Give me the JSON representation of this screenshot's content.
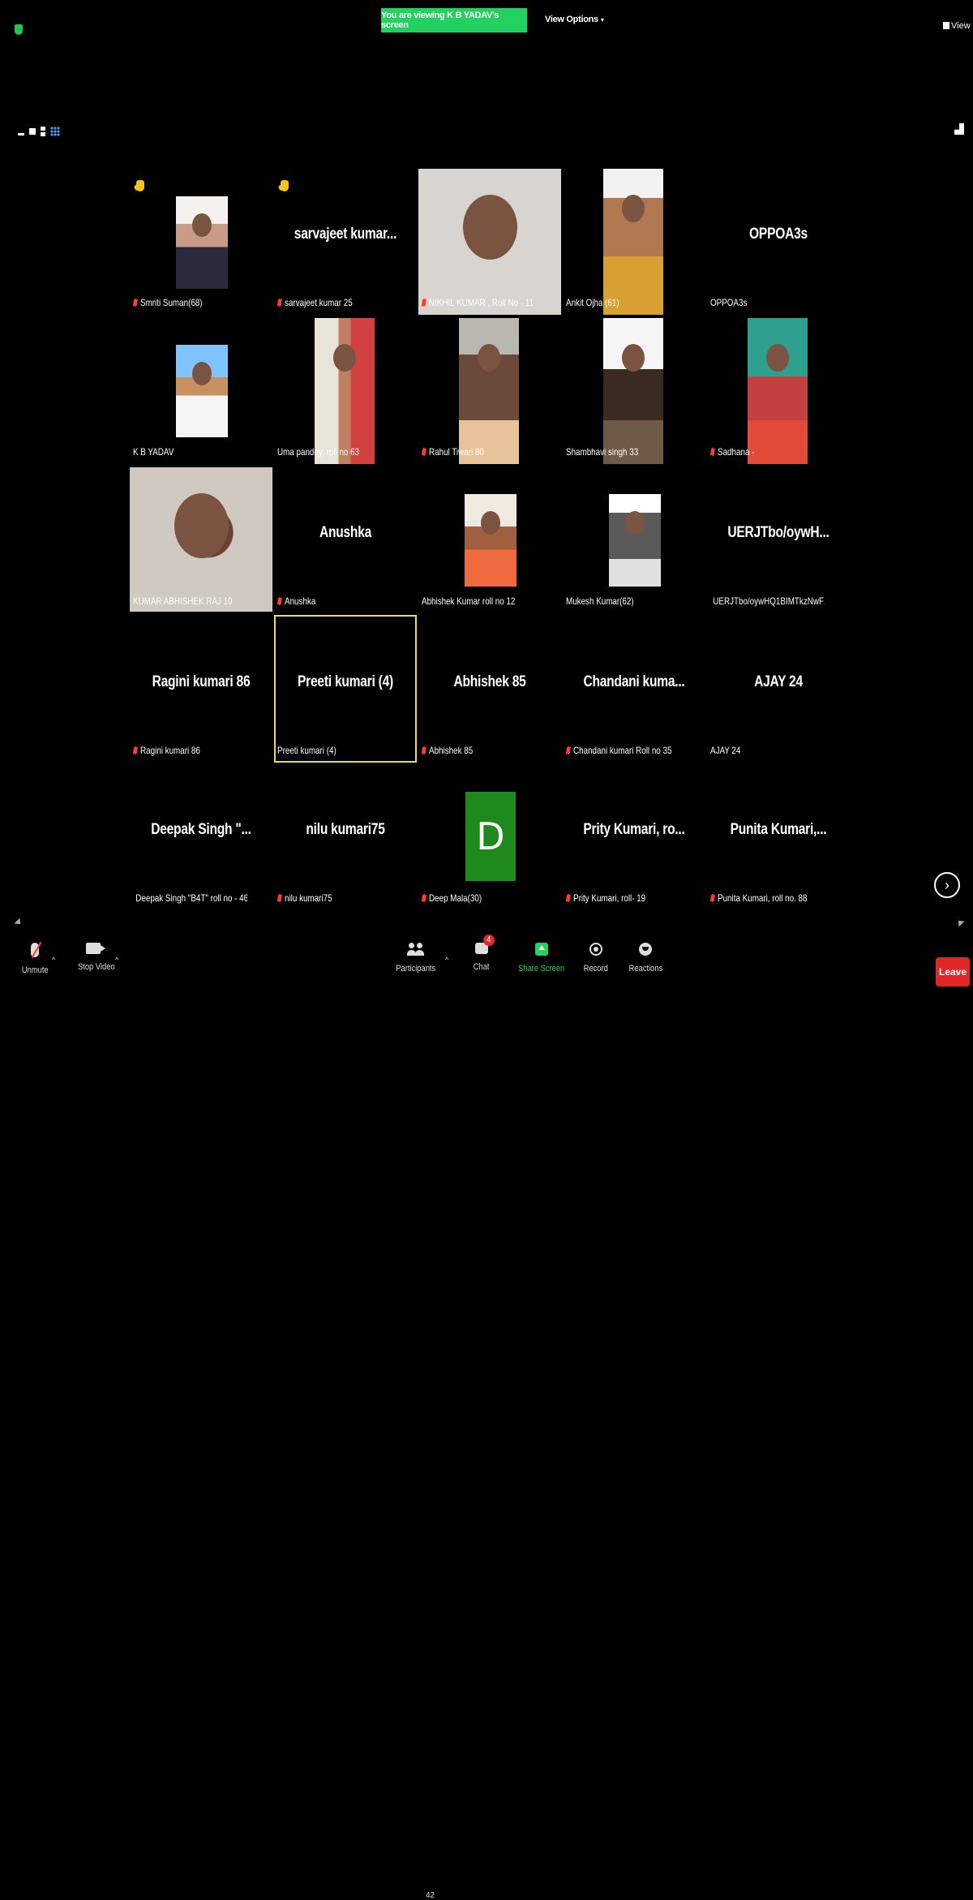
{
  "header": {
    "banner": "You are viewing K B YADAV's screen",
    "view_options": "View Options",
    "view_right": "View"
  },
  "tiles": [
    {
      "name": "Smriti Suman(68)",
      "big": "",
      "muted": true,
      "hand": true,
      "photo": "smriti"
    },
    {
      "name": "sarvajeet kumar 25",
      "big": "sarvajeet kumar...",
      "muted": true,
      "hand": true
    },
    {
      "name": "NIKHIL KUMAR , Roll No - 11",
      "big": "",
      "muted": true,
      "photo": "nikhil"
    },
    {
      "name": "Ankit Ojha (61)",
      "big": "",
      "muted": false,
      "photo": "ankit"
    },
    {
      "name": "OPPOA3s",
      "big": "OPPOA3s",
      "muted": false
    },
    {
      "name": "K B YADAV",
      "big": "",
      "muted": false,
      "photo": "kb"
    },
    {
      "name": "Uma pandey, roll no 63",
      "big": "",
      "muted": false,
      "photo": "uma"
    },
    {
      "name": "Rahul Tiwari 80",
      "big": "",
      "muted": true,
      "photo": "rahul"
    },
    {
      "name": "Shambhavi singh 33",
      "big": "",
      "muted": false,
      "photo": "sham"
    },
    {
      "name": "Sadhana -",
      "big": "",
      "muted": true,
      "photo": "sadhana"
    },
    {
      "name": "KUMAR ABHISHEK RAJ 10",
      "big": "",
      "muted": false,
      "photo": "abhiraj"
    },
    {
      "name": "Anushka",
      "big": "Anushka",
      "muted": true
    },
    {
      "name": "Abhishek Kumar roll no 12",
      "big": "",
      "muted": false,
      "photo": "abhishek12"
    },
    {
      "name": "Mukesh Kumar(62)",
      "big": "",
      "muted": false,
      "photo": "mukesh"
    },
    {
      "name": "UERJTbo/oywHQ1BIMTkzNwF1AA...",
      "big": "UERJTbo/oywH...",
      "muted": true
    },
    {
      "name": "Ragini kumari 86",
      "big": "Ragini kumari 86",
      "muted": true
    },
    {
      "name": "Preeti kumari (4)",
      "big": "Preeti kumari (4)",
      "muted": false,
      "active": true
    },
    {
      "name": "Abhishek 85",
      "big": "Abhishek 85",
      "muted": true
    },
    {
      "name": "Chandani kumari Roll no 35",
      "big": "Chandani kuma...",
      "muted": true
    },
    {
      "name": "AJAY 24",
      "big": "AJAY 24",
      "muted": false
    },
    {
      "name": "Deepak Singh \"B4T\" roll no - 46",
      "big": "Deepak Singh \"...",
      "muted": true
    },
    {
      "name": "nilu kumari75",
      "big": "nilu kumari75",
      "muted": true
    },
    {
      "name": "Deep Mala(30)",
      "big": "",
      "muted": true,
      "letter": "D"
    },
    {
      "name": "Prity Kumari, roll- 19",
      "big": "Prity Kumari, ro...",
      "muted": true
    },
    {
      "name": "Punita Kumari, roll no. 88",
      "big": "Punita Kumari,...",
      "muted": true
    }
  ],
  "toolbar": {
    "unmute": "Unmute",
    "stop_video": "Stop Video",
    "participants": "Participants",
    "participants_count": "42",
    "chat": "Chat",
    "chat_badge": "4",
    "share_screen": "Share Screen",
    "record": "Record",
    "reactions": "Reactions",
    "leave": "Leave"
  },
  "colors": {
    "banner": "#23d160",
    "leave": "#e02828",
    "active_border": "#e8d96a",
    "muted_icon": "#ff3b30",
    "avatar_D": "#1e8a1e"
  }
}
